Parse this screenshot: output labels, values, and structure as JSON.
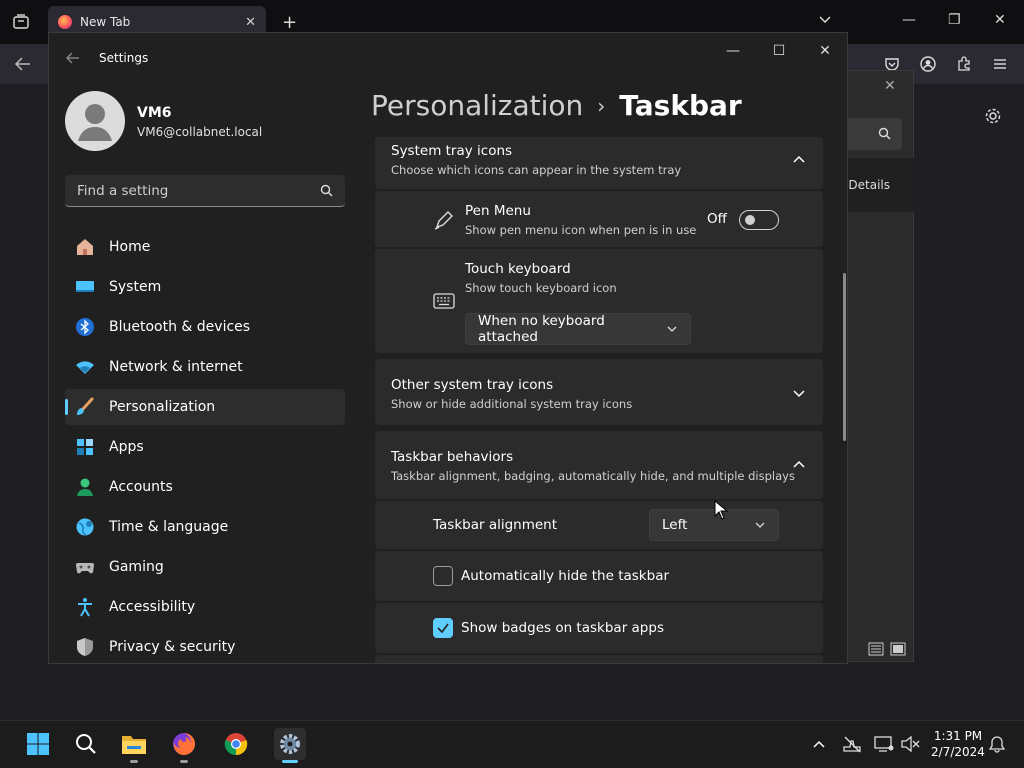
{
  "browser": {
    "tab_title": "New Tab",
    "new_tab_label": "+"
  },
  "bg_dialog": {
    "details_label": "Details"
  },
  "settings": {
    "window_title": "Settings",
    "user": {
      "name": "VM6",
      "email": "VM6@collabnet.local"
    },
    "search": {
      "placeholder": "Find a setting"
    },
    "nav": [
      {
        "label": "Home",
        "icon": "home-icon"
      },
      {
        "label": "System",
        "icon": "system-icon"
      },
      {
        "label": "Bluetooth & devices",
        "icon": "bluetooth-icon"
      },
      {
        "label": "Network & internet",
        "icon": "wifi-icon"
      },
      {
        "label": "Personalization",
        "icon": "brush-icon",
        "active": true
      },
      {
        "label": "Apps",
        "icon": "apps-icon"
      },
      {
        "label": "Accounts",
        "icon": "accounts-icon"
      },
      {
        "label": "Time & language",
        "icon": "globe-icon"
      },
      {
        "label": "Gaming",
        "icon": "gamepad-icon"
      },
      {
        "label": "Accessibility",
        "icon": "accessibility-icon"
      },
      {
        "label": "Privacy & security",
        "icon": "shield-icon"
      }
    ],
    "breadcrumb": {
      "parent": "Personalization",
      "separator": "›",
      "current": "Taskbar"
    },
    "sections": {
      "system_tray": {
        "title": "System tray icons",
        "subtitle": "Choose which icons can appear in the system tray",
        "pen_menu": {
          "title": "Pen Menu",
          "subtitle": "Show pen menu icon when pen is in use",
          "state_label": "Off"
        },
        "touch_keyboard": {
          "title": "Touch keyboard",
          "subtitle": "Show touch keyboard icon",
          "dropdown_value": "When no keyboard attached"
        }
      },
      "other_tray": {
        "title": "Other system tray icons",
        "subtitle": "Show or hide additional system tray icons"
      },
      "behaviors": {
        "title": "Taskbar behaviors",
        "subtitle": "Taskbar alignment, badging, automatically hide, and multiple displays",
        "alignment": {
          "label": "Taskbar alignment",
          "value": "Left"
        },
        "auto_hide": {
          "label": "Automatically hide the taskbar",
          "checked": false
        },
        "badges": {
          "label": "Show badges on taskbar apps",
          "checked": true
        }
      }
    }
  },
  "taskbar": {
    "clock": {
      "time": "1:31 PM",
      "date": "2/7/2024"
    }
  },
  "colors": {
    "accent": "#60cdff",
    "window_bg": "#202020",
    "card_bg": "#2b2b2b"
  }
}
